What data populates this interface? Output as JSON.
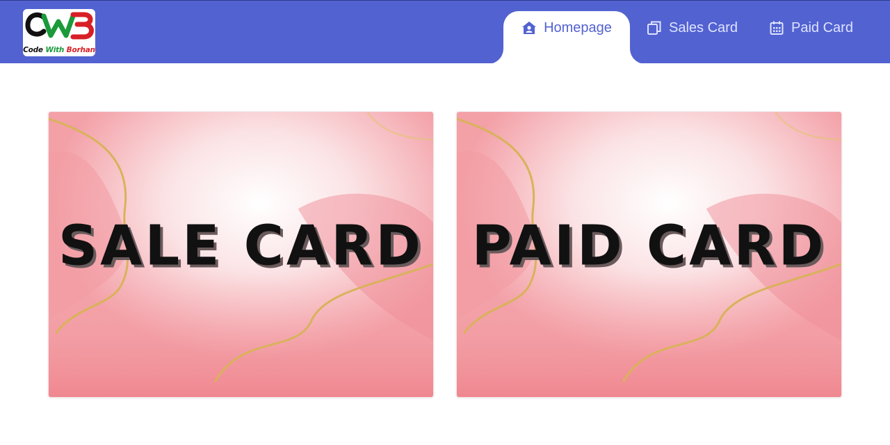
{
  "brand": {
    "logo_letters": "CWB",
    "caption": {
      "word1": "Code",
      "word2": "With",
      "word3": "Borhan"
    }
  },
  "nav": {
    "tabs": [
      {
        "label": "Homepage",
        "icon": "home-icon",
        "active": true
      },
      {
        "label": "Sales Card",
        "icon": "copy-icon",
        "active": false
      },
      {
        "label": "Paid Card",
        "icon": "calendar-icon",
        "active": false
      }
    ]
  },
  "cards": [
    {
      "title": "SALE CARD"
    },
    {
      "title": "PAID CARD"
    }
  ],
  "colors": {
    "navbar": "#5262d1",
    "active_tab_text": "#5262d1",
    "inactive_tab_text": "#dfe3ff",
    "card_pink": "#f3a0a7",
    "gold_vein": "#d9b25a"
  }
}
